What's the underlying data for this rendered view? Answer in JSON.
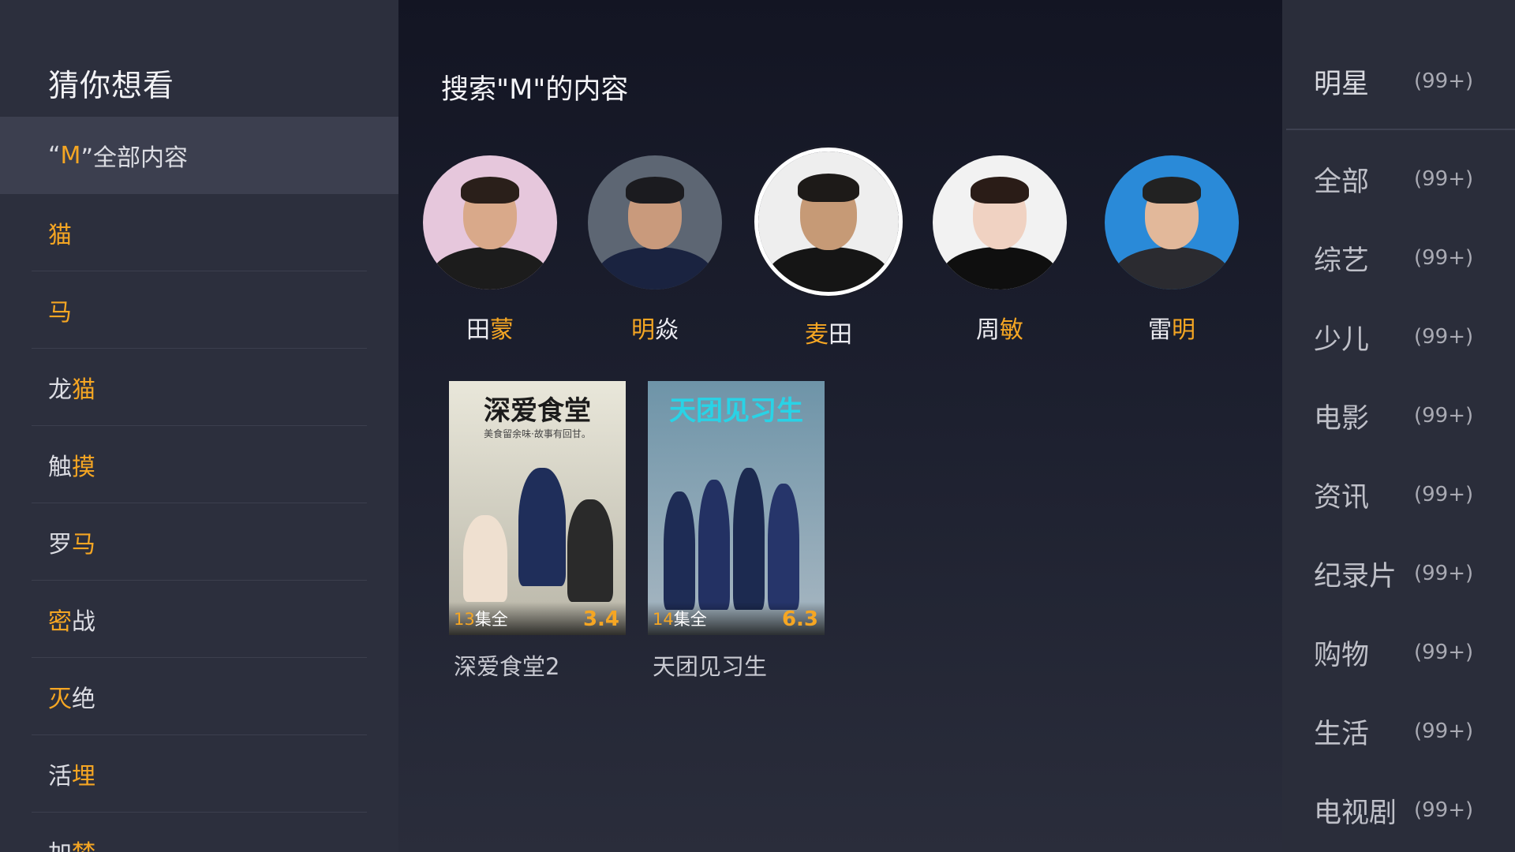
{
  "left_panel": {
    "title": "猜你想看",
    "items": [
      {
        "parts": [
          {
            "t": "“",
            "h": false
          },
          {
            "t": "M",
            "h": true
          },
          {
            "t": "”全部内容",
            "h": false
          }
        ],
        "active": true
      },
      {
        "parts": [
          {
            "t": "猫",
            "h": true
          }
        ]
      },
      {
        "parts": [
          {
            "t": "马",
            "h": true
          }
        ]
      },
      {
        "parts": [
          {
            "t": "龙",
            "h": false
          },
          {
            "t": "猫",
            "h": true
          }
        ]
      },
      {
        "parts": [
          {
            "t": "触",
            "h": false
          },
          {
            "t": "摸",
            "h": true
          }
        ]
      },
      {
        "parts": [
          {
            "t": "罗",
            "h": false
          },
          {
            "t": "马",
            "h": true
          }
        ]
      },
      {
        "parts": [
          {
            "t": "密",
            "h": true
          },
          {
            "t": "战",
            "h": false
          }
        ]
      },
      {
        "parts": [
          {
            "t": "灭",
            "h": true
          },
          {
            "t": "绝",
            "h": false
          }
        ]
      },
      {
        "parts": [
          {
            "t": "活",
            "h": false
          },
          {
            "t": "埋",
            "h": true
          }
        ]
      },
      {
        "parts": [
          {
            "t": "加",
            "h": false
          },
          {
            "t": "梦",
            "h": true
          }
        ]
      }
    ]
  },
  "center": {
    "search_title": "搜索\"M\"的内容",
    "people": [
      {
        "parts": [
          {
            "t": "田",
            "h": false
          },
          {
            "t": "蒙",
            "h": true
          }
        ],
        "focused": false,
        "bg": "#e6c7dc",
        "skin": "#d9a98a",
        "hair": "#2a1f1a",
        "body": "#1c1c1c"
      },
      {
        "parts": [
          {
            "t": "明",
            "h": true
          },
          {
            "t": "焱",
            "h": false
          }
        ],
        "focused": false,
        "bg": "#5d6673",
        "skin": "#c99a7c",
        "hair": "#1b1b1f",
        "body": "#1a2340"
      },
      {
        "parts": [
          {
            "t": "麦",
            "h": true
          },
          {
            "t": "田",
            "h": false
          }
        ],
        "focused": true,
        "bg": "#eeeeee",
        "skin": "#c69a76",
        "hair": "#1d1a18",
        "body": "#151515"
      },
      {
        "parts": [
          {
            "t": "周",
            "h": false
          },
          {
            "t": "敏",
            "h": true
          }
        ],
        "focused": false,
        "bg": "#f2f2f2",
        "skin": "#f0d2c2",
        "hair": "#2a1c17",
        "body": "#0f0f0f"
      },
      {
        "parts": [
          {
            "t": "雷",
            "h": false
          },
          {
            "t": "明",
            "h": true
          }
        ],
        "focused": false,
        "bg": "#2a8ad8",
        "skin": "#e2b89a",
        "hair": "#222",
        "body": "#2b2b30"
      }
    ],
    "posters": [
      {
        "title_art": "深爱食堂",
        "subtitle_art": "美食留余味·故事有回甘。",
        "eps_num": "13",
        "eps_suffix": "集全",
        "score": "3.4",
        "caption": "深爱食堂2",
        "bg_top": "#e9e7da",
        "bg_bottom": "#b9b6a8",
        "title_color": "#1b1b1b"
      },
      {
        "title_art": "天团见习生",
        "subtitle_art": "",
        "eps_num": "14",
        "eps_suffix": "集全",
        "score": "6.3",
        "caption": "天团见习生",
        "bg_top": "#6e94a8",
        "bg_bottom": "#a8b7c2",
        "title_color": "#29d3e6"
      }
    ]
  },
  "right_panel": {
    "header": {
      "label": "明星",
      "count": "(99+)"
    },
    "categories": [
      {
        "label": "全部",
        "count": "(99+)"
      },
      {
        "label": "综艺",
        "count": "(99+)"
      },
      {
        "label": "少儿",
        "count": "(99+)"
      },
      {
        "label": "电影",
        "count": "(99+)"
      },
      {
        "label": "资讯",
        "count": "(99+)"
      },
      {
        "label": "纪录片",
        "count": "(99+)"
      },
      {
        "label": "购物",
        "count": "(99+)"
      },
      {
        "label": "生活",
        "count": "(99+)"
      },
      {
        "label": "电视剧",
        "count": "(99+)"
      }
    ]
  }
}
